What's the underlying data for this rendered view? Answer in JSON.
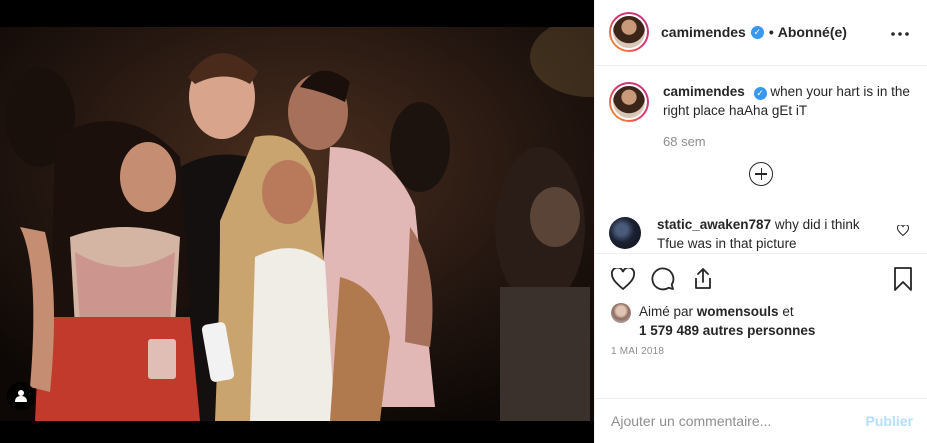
{
  "post": {
    "author": "camimendes",
    "follow_status": "Abonné(e)",
    "separator": "•",
    "more_icon": "more-horizontal-icon"
  },
  "caption": {
    "username": "camimendes",
    "text": "when your hart is in the right place haAha gEt iT",
    "time": "68 sem"
  },
  "comments": [
    {
      "username": "static_awaken787",
      "text": "why did i think Tfue was in that picture"
    }
  ],
  "likes": {
    "prefix": "Aimé par",
    "first_liker": "womensouls",
    "connector": "et",
    "count_text": "1 579 489 autres personnes"
  },
  "date": "1 MAI 2018",
  "add_comment": {
    "placeholder": "Ajouter un commentaire...",
    "publish_label": "Publier"
  },
  "icons": {
    "verified": "verified-badge-icon",
    "like": "heart-icon",
    "comment": "comment-bubble-icon",
    "share": "share-icon",
    "save": "bookmark-icon",
    "load_more": "plus-circle-icon",
    "user_tag": "user-tag-icon"
  },
  "colors": {
    "verified_blue": "#3897f0",
    "publish_disabled": "#b2dffc",
    "muted_text": "#8e8e8e"
  }
}
